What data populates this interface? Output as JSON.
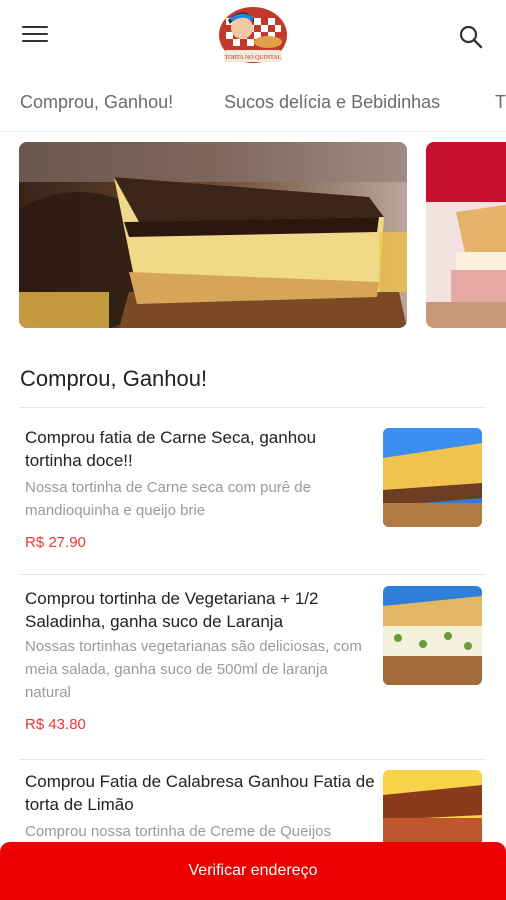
{
  "header": {
    "menu_icon": "hamburger-menu-icon",
    "logo_text": "TORTA NO QUINTAL",
    "search_icon": "search-icon"
  },
  "tabs": [
    {
      "label": "Comprou, Ganhou!"
    },
    {
      "label": "Sucos delícia e Bebidinhas"
    },
    {
      "label": "T"
    }
  ],
  "section": {
    "title": "Comprou, Ganhou!"
  },
  "products": [
    {
      "name": "Comprou fatia de Carne Seca, ganhou tortinha doce!!",
      "description": "Nossa tortinha de Carne seca com purê de mandioquinha e queijo brie",
      "price": "R$ 27.90"
    },
    {
      "name": "Comprou tortinha de Vegetariana + 1/2 Saladinha, ganha suco de Laranja",
      "description": "Nossas tortinhas vegetarianas são deliciosas, com meia salada, ganha suco de 500ml de laranja natural",
      "price": "R$ 43.80"
    },
    {
      "name": "Comprou Fatia de Calabresa Ganhou Fatia de torta de Limão",
      "description": "Comprou nossa tortinha de Creme de Queijos",
      "price": ""
    }
  ],
  "cta": {
    "label": "Verificar endereço"
  },
  "colors": {
    "accent": "#ee0000",
    "price": "#e53935"
  }
}
